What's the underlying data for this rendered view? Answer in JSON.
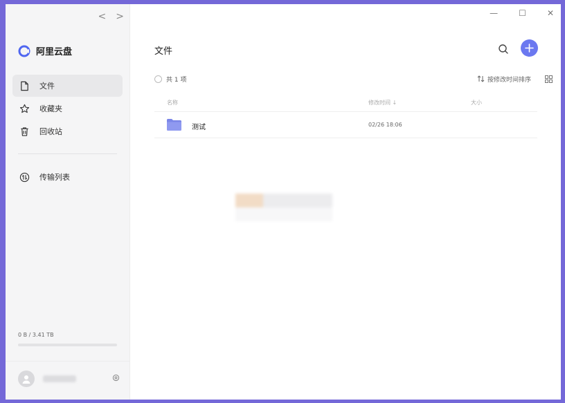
{
  "nav_arrows": {
    "back": "<",
    "forward": ">"
  },
  "brand": {
    "name": "阿里云盘"
  },
  "sidebar": {
    "items": [
      {
        "label": "文件",
        "icon": "file-icon",
        "active": true
      },
      {
        "label": "收藏夹",
        "icon": "star-icon",
        "active": false
      },
      {
        "label": "回收站",
        "icon": "trash-icon",
        "active": false
      }
    ],
    "transfer": {
      "label": "传输列表",
      "icon": "transfer-icon"
    }
  },
  "storage": {
    "text": "0 B / 3.41 TB",
    "used_fraction": 0
  },
  "window_controls": {
    "minimize": "—",
    "maximize": "☐",
    "close": "✕"
  },
  "main": {
    "title": "文件",
    "count_text": "共 1 项",
    "sort_label": "按修改时间排序",
    "columns": {
      "name": "名称",
      "modified": "修改时间",
      "size": "大小"
    },
    "files": [
      {
        "name": "测试",
        "modified": "02/26 18:06",
        "size": ""
      }
    ]
  },
  "colors": {
    "accent": "#6b78f0",
    "frame": "#7468d8",
    "folder": "#7b86e8"
  }
}
